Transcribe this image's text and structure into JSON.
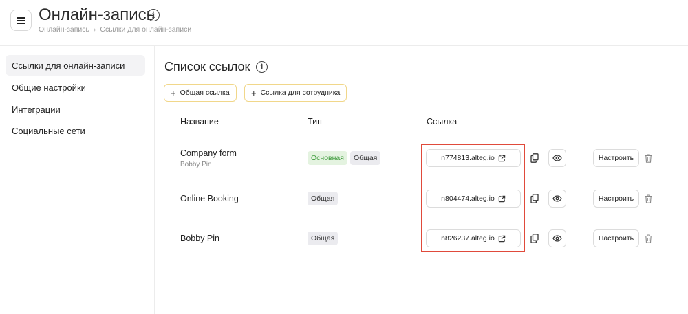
{
  "header": {
    "title": "Онлайн-запись",
    "info_glyph": "i",
    "breadcrumb": [
      "Онлайн-запись",
      "Ссылки для онлайн-записи"
    ],
    "breadcrumb_separator": "›"
  },
  "sidebar": {
    "items": [
      {
        "label": "Ссылки для онлайн-записи",
        "active": true
      },
      {
        "label": "Общие настройки",
        "active": false
      },
      {
        "label": "Интеграции",
        "active": false
      },
      {
        "label": "Социальные сети",
        "active": false
      }
    ]
  },
  "main": {
    "title": "Список ссылок",
    "info_glyph": "i",
    "buttons": {
      "add_common": "Общая ссылка",
      "add_employee": "Ссылка для сотрудника",
      "plus": "+"
    },
    "columns": {
      "name": "Название",
      "type": "Тип",
      "link": "Ссылка"
    },
    "setup_label": "Настроить",
    "rows": [
      {
        "name": "Company form",
        "sub": "Bobby Pin",
        "tags": [
          "Основная",
          "Общая"
        ],
        "link": "n774813.alteg.io"
      },
      {
        "name": "Online Booking",
        "sub": "",
        "tags": [
          "Общая"
        ],
        "link": "n804474.alteg.io"
      },
      {
        "name": "Bobby Pin",
        "sub": "",
        "tags": [
          "Общая"
        ],
        "link": "n826237.alteg.io"
      }
    ]
  },
  "icons": {
    "menu": "hamburger-icon",
    "info": "info-icon",
    "external": "external-link-icon",
    "copy": "copy-icon",
    "eye": "eye-icon",
    "trash": "trash-icon"
  },
  "colors": {
    "button_border": "#f1d78a",
    "main_tag_bg": "#e4f3e0",
    "main_tag_text": "#3c9a3a",
    "common_tag_bg": "#ebebef",
    "highlight": "#e04a3b"
  }
}
